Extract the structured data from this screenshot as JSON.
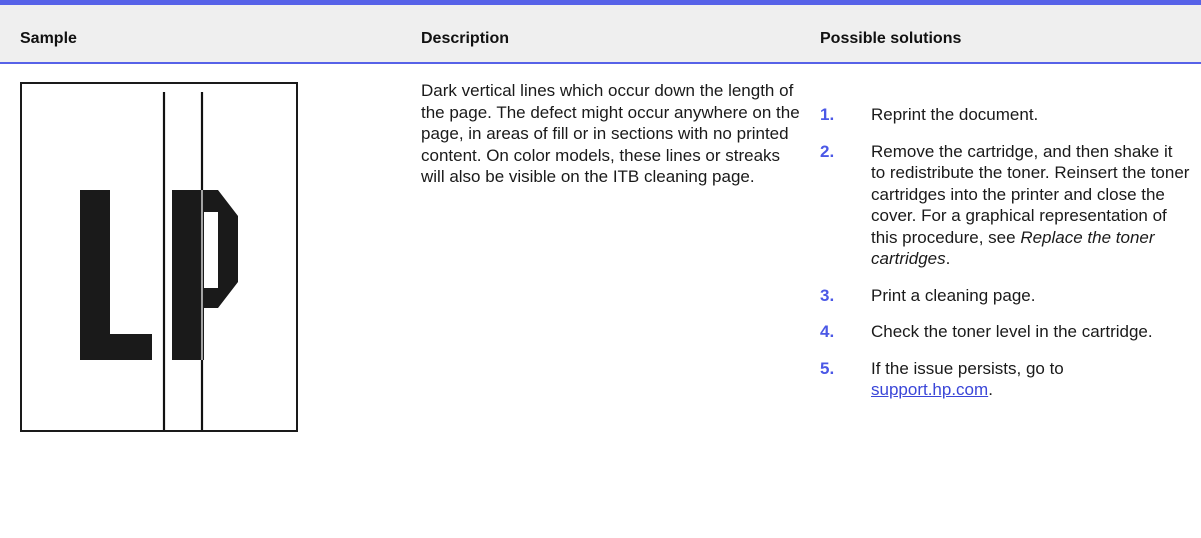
{
  "table": {
    "headers": {
      "sample": "Sample",
      "description": "Description",
      "solutions": "Possible solutions"
    },
    "sample_image": {
      "letters": [
        "L",
        "P"
      ],
      "icon": "print-sample-with-vertical-lines"
    },
    "description": "Dark vertical lines which occur down the length of the page. The defect might occur anywhere on the page, in areas of fill or in sections with no printed content. On color models, these lines or streaks will also be visible on the ITB cleaning page.",
    "solutions": [
      {
        "num": "1.",
        "text": "Reprint the document."
      },
      {
        "num": "2.",
        "text": "Remove the cartridge, and then shake it to redistribute the toner. Reinsert the toner cartridges into the printer and close the cover. For a graphical representation of this procedure, see ",
        "emphasis": "Replace the toner cartridges",
        "tail": "."
      },
      {
        "num": "3.",
        "text": "Print a cleaning page."
      },
      {
        "num": "4.",
        "text": "Check the toner level in the cartridge."
      },
      {
        "num": "5.",
        "text": "If the issue persists, go to ",
        "link": "support.hp.com",
        "tail": "."
      }
    ]
  },
  "colors": {
    "accent": "#5762e8",
    "header_bg": "#efefef",
    "number": "#4b58e6",
    "link": "#3a46d8"
  }
}
